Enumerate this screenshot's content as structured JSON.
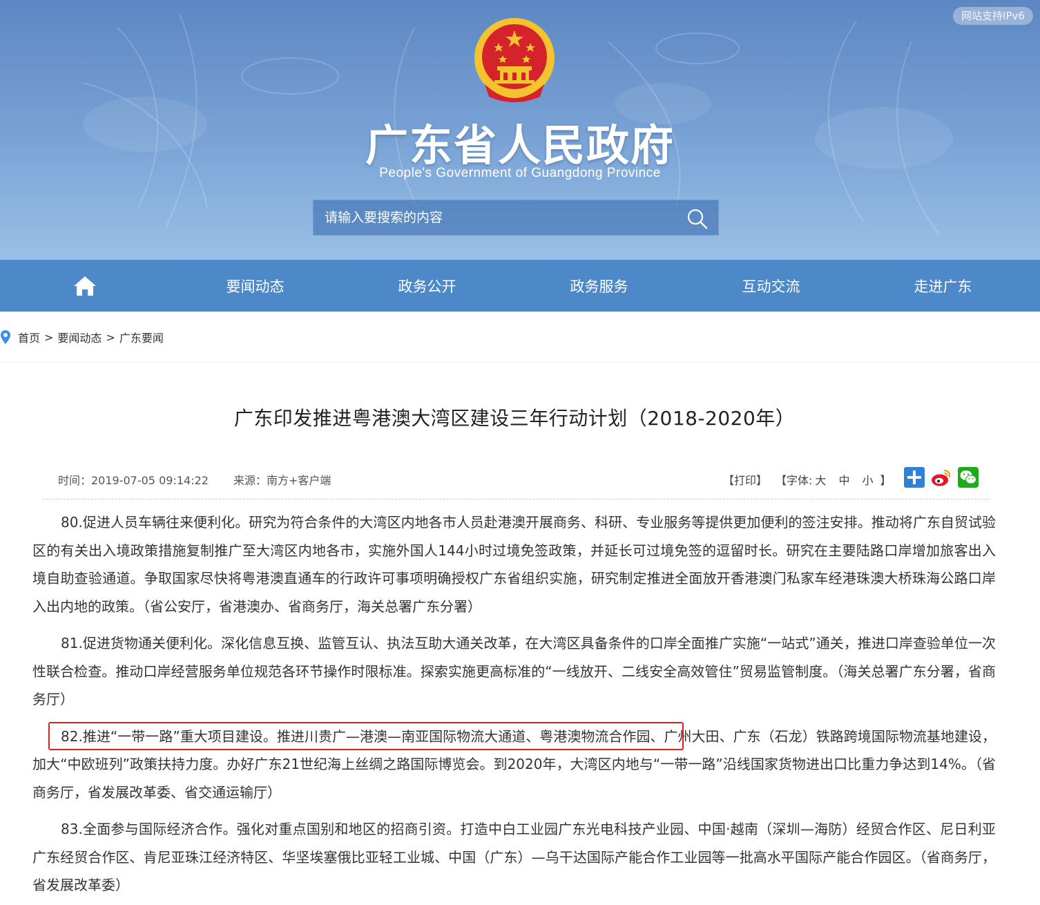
{
  "header": {
    "ipv6_badge": "网站支持IPv6",
    "site_title": "广东省人民政府",
    "site_subtitle": "People's Government of Guangdong Province",
    "search_placeholder": "请输入要搜索的内容"
  },
  "nav": {
    "items": [
      "要闻动态",
      "政务公开",
      "政务服务",
      "互动交流",
      "走进广东"
    ]
  },
  "breadcrumb": {
    "items": [
      "首页",
      "要闻动态",
      "广东要闻"
    ],
    "separator": ">"
  },
  "article": {
    "title": "广东印发推进粤港澳大湾区建设三年行动计划（2018-2020年）",
    "time": "时间：2019-07-05 09:14:22",
    "source": "来源：南方+客户端",
    "print": "【打印】",
    "font_label": "【字体:",
    "font_large": "大",
    "font_medium": "中",
    "font_small": "小",
    "font_end": "】",
    "paragraphs": [
      "80.促进人员车辆往来便利化。研究为符合条件的大湾区内地各市人员赴港澳开展商务、科研、专业服务等提供更加便利的签注安排。推动将广东自贸试验区的有关出入境政策措施复制推广至大湾区内地各市，实施外国人144小时过境免签政策，并延长可过境免签的逗留时长。研究在主要陆路口岸增加旅客出入境自助查验通道。争取国家尽快将粤港澳直通车的行政许可事项明确授权广东省组织实施，研究制定推进全面放开香港澳门私家车经港珠澳大桥珠海公路口岸入出内地的政策。（省公安厅，省港澳办、省商务厅，海关总署广东分署）",
      "81.促进货物通关便利化。深化信息互换、监管互认、执法互助大通关改革，在大湾区具备条件的口岸全面推广实施“一站式”通关，推进口岸查验单位一次性联合检查。推动口岸经营服务单位规范各环节操作时限标准。探索实施更高标准的“一线放开、二线安全高效管住”贸易监管制度。（海关总署广东分署，省商务厅）",
      "82.推进“一带一路”重大项目建设。推进川贵广—港澳—南亚国际物流大通道、粤港澳物流合作园、广州大田、广东（石龙）铁路跨境国际物流基地建设，加大“中欧班列”政策扶持力度。办好广东21世纪海上丝绸之路国际博览会。到2020年，大湾区内地与“一带一路”沿线国家货物进出口比重力争达到14%。（省商务厅，省发展改革委、省交通运输厅）",
      "83.全面参与国际经济合作。强化对重点国别和地区的招商引资。打造中白工业园广东光电科技产业园、中国·越南（深圳—海防）经贸合作区、尼日利亚广东经贸合作区、肯尼亚珠江经济特区、华坚埃塞俄比亚轻工业城、中国（广东）—乌干达国际产能合作工业园等一批高水平国际产能合作园区。（省商务厅，省发展改革委）"
    ]
  },
  "colors": {
    "nav_bg": "#4d88c9",
    "header_bg": "#6f98cf",
    "highlight": "#e02020",
    "emblem_red": "#d4232a",
    "emblem_gold": "#f5c230"
  },
  "icons": {
    "home": "home-icon",
    "search": "search-icon",
    "location": "location-pin-icon",
    "share_plus": "share-plus-icon",
    "weibo": "weibo-icon",
    "wechat": "wechat-icon"
  }
}
